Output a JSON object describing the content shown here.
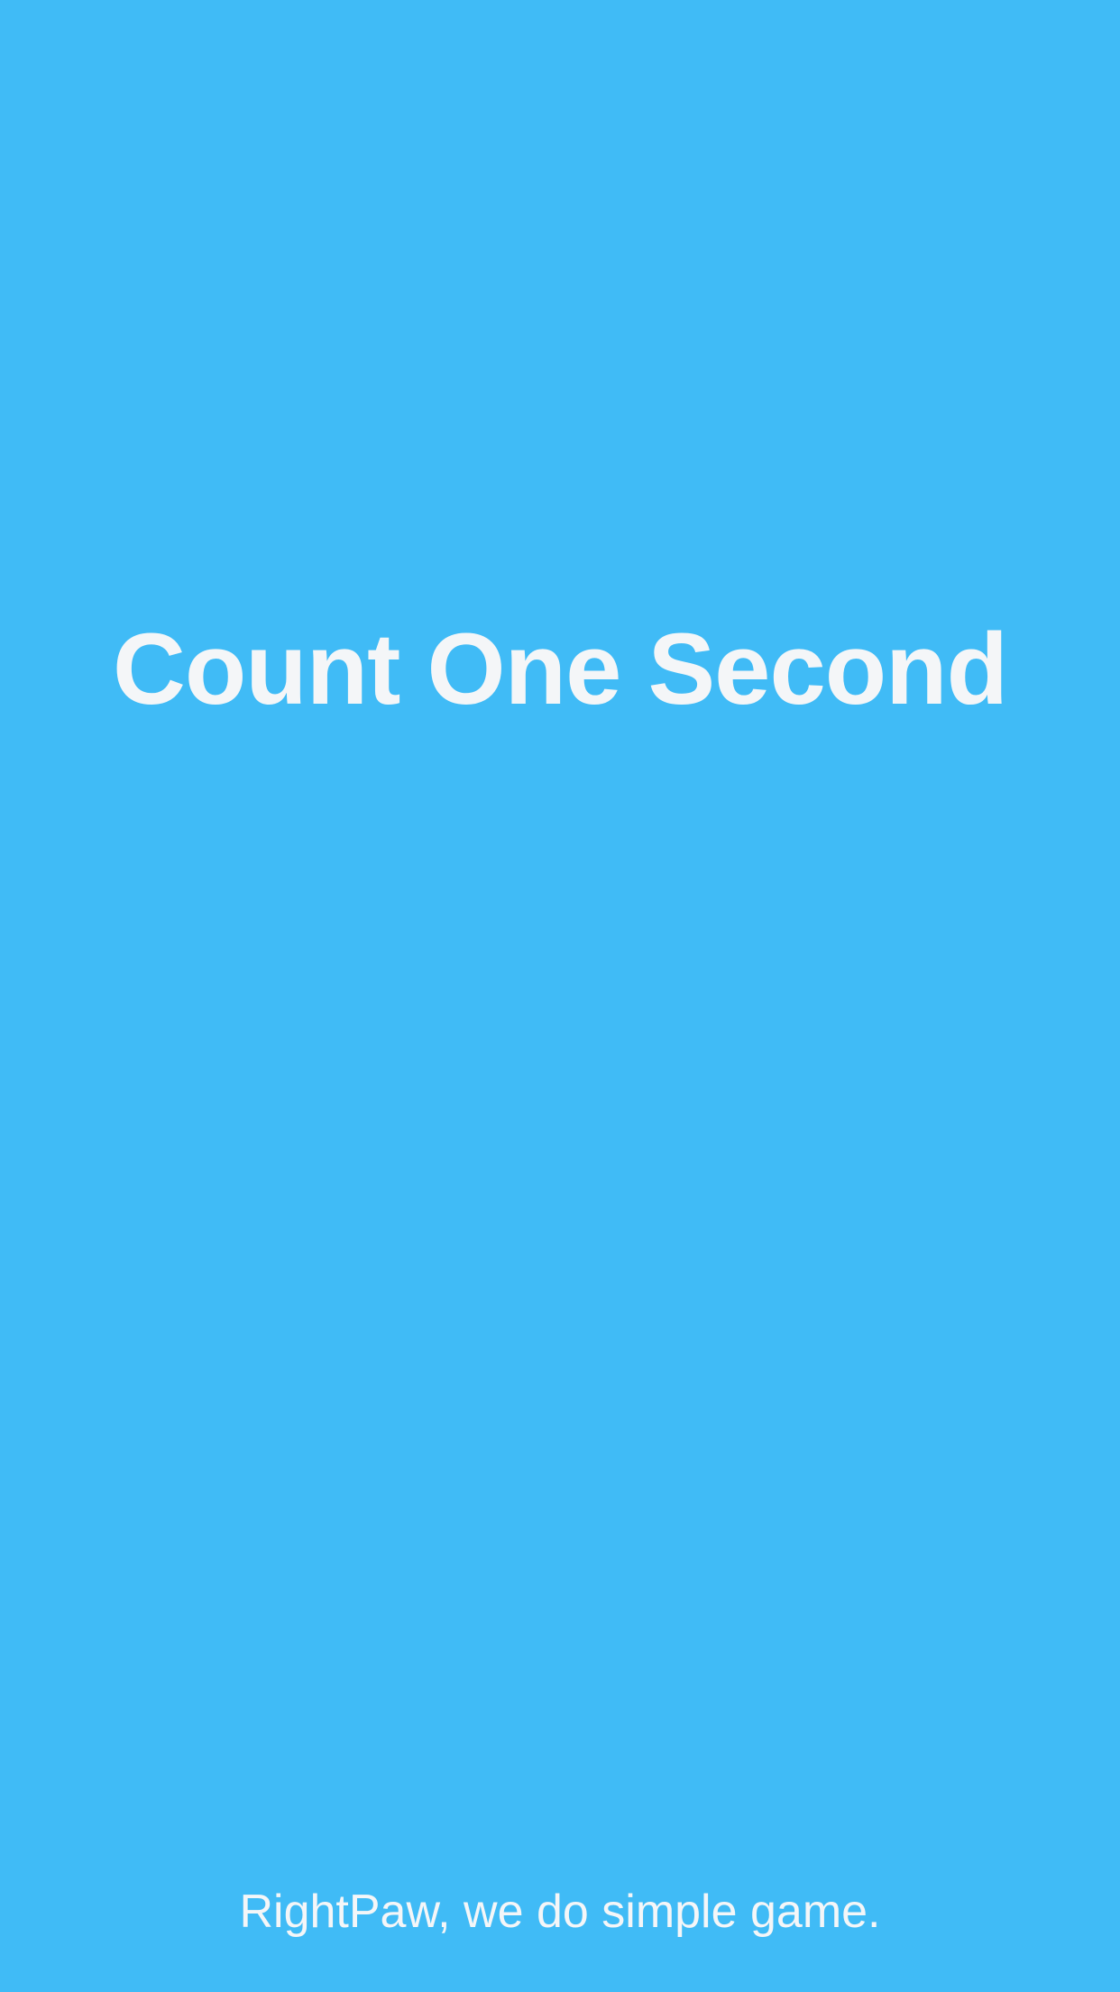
{
  "splash": {
    "title": "Count One Second",
    "tagline": "RightPaw, we do simple game."
  },
  "colors": {
    "background": "#40BBF6",
    "text": "#F4F6F8"
  }
}
